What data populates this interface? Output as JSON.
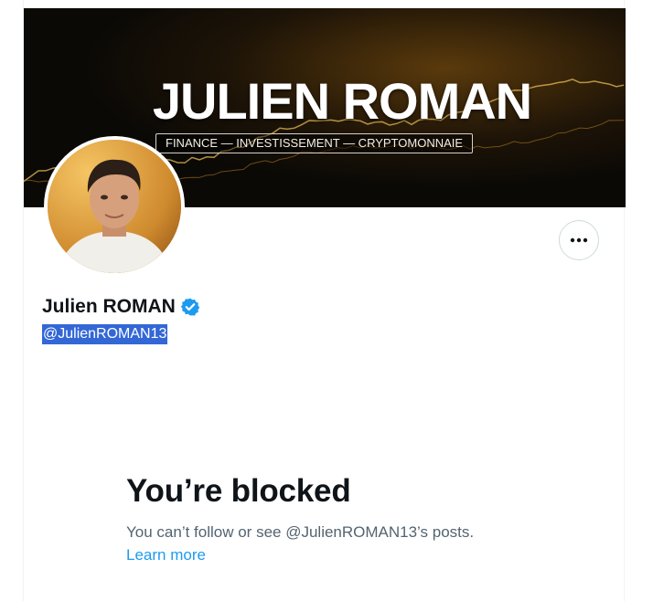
{
  "banner": {
    "title": "JULIEN ROMAN",
    "tagline": "FINANCE — INVESTISSEMENT — CRYPTOMONNAIE",
    "colors": {
      "background": "#0b0906",
      "gold": "#f2b73a"
    }
  },
  "profile": {
    "display_name": "Julien ROMAN",
    "handle": "@JulienROMAN13",
    "verified": true,
    "avatar_icon": "profile-photo",
    "more_icon": "more-horizontal-icon"
  },
  "blocked": {
    "title": "You’re blocked",
    "message": "You can’t follow or see @JulienROMAN13’s posts.",
    "learn_more": "Learn more"
  },
  "colors": {
    "text_primary": "#0f1419",
    "text_secondary": "#536471",
    "link": "#1d9bf0",
    "verified": "#1d9bf0",
    "selection": "#3367d6"
  }
}
